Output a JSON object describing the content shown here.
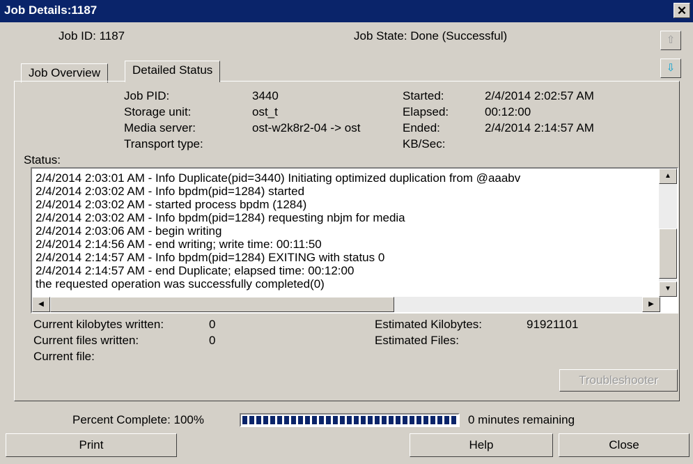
{
  "window": {
    "title": "Job Details:1187",
    "close_label": "✕"
  },
  "header": {
    "job_id": "Job ID: 1187",
    "job_state": "Job State: Done (Successful)"
  },
  "tabs": [
    "Job Overview",
    "Detailed Status"
  ],
  "details": {
    "left": [
      {
        "label": "Job PID:",
        "value": "3440"
      },
      {
        "label": "Storage unit:",
        "value": "ost_t"
      },
      {
        "label": "Media server:",
        "value": "ost-w2k8r2-04 -> ost"
      },
      {
        "label": "Transport type:",
        "value": ""
      }
    ],
    "right": [
      {
        "label": "Started:",
        "value": "2/4/2014 2:02:57 AM"
      },
      {
        "label": "Elapsed:",
        "value": "00:12:00"
      },
      {
        "label": "Ended:",
        "value": "2/4/2014 2:14:57 AM"
      },
      {
        "label": "KB/Sec:",
        "value": ""
      }
    ]
  },
  "status": {
    "label": "Status:",
    "lines": [
      "2/4/2014 2:03:01 AM - Info Duplicate(pid=3440) Initiating optimized duplication from @aaabv",
      "2/4/2014 2:03:02 AM - Info bpdm(pid=1284) started",
      "2/4/2014 2:03:02 AM - started process bpdm (1284)",
      "2/4/2014 2:03:02 AM - Info bpdm(pid=1284) requesting nbjm for media",
      "2/4/2014 2:03:06 AM - begin writing",
      "2/4/2014 2:14:56 AM - end writing; write time: 00:11:50",
      "2/4/2014 2:14:57 AM - Info bpdm(pid=1284) EXITING with status 0",
      "2/4/2014 2:14:57 AM - end Duplicate; elapsed time: 00:12:00",
      "the requested operation was successfully completed(0)"
    ]
  },
  "stats": {
    "kb_written_label": "Current kilobytes written:",
    "kb_written": "0",
    "files_written_label": "Current files written:",
    "files_written": "0",
    "current_file_label": "Current file:",
    "est_kb_label": "Estimated Kilobytes:",
    "est_kb": "91921101",
    "est_files_label": "Estimated Files:"
  },
  "buttons": {
    "troubleshooter": "Troubleshooter",
    "print": "Print",
    "help": "Help",
    "close": "Close"
  },
  "progress": {
    "label": "Percent Complete: 100%",
    "percent": 100,
    "remaining": "0 minutes remaining"
  },
  "colors": {
    "titlebar": "#0a246a",
    "window_bg": "#d4d0c8",
    "progress_fill": "#0a246a"
  }
}
